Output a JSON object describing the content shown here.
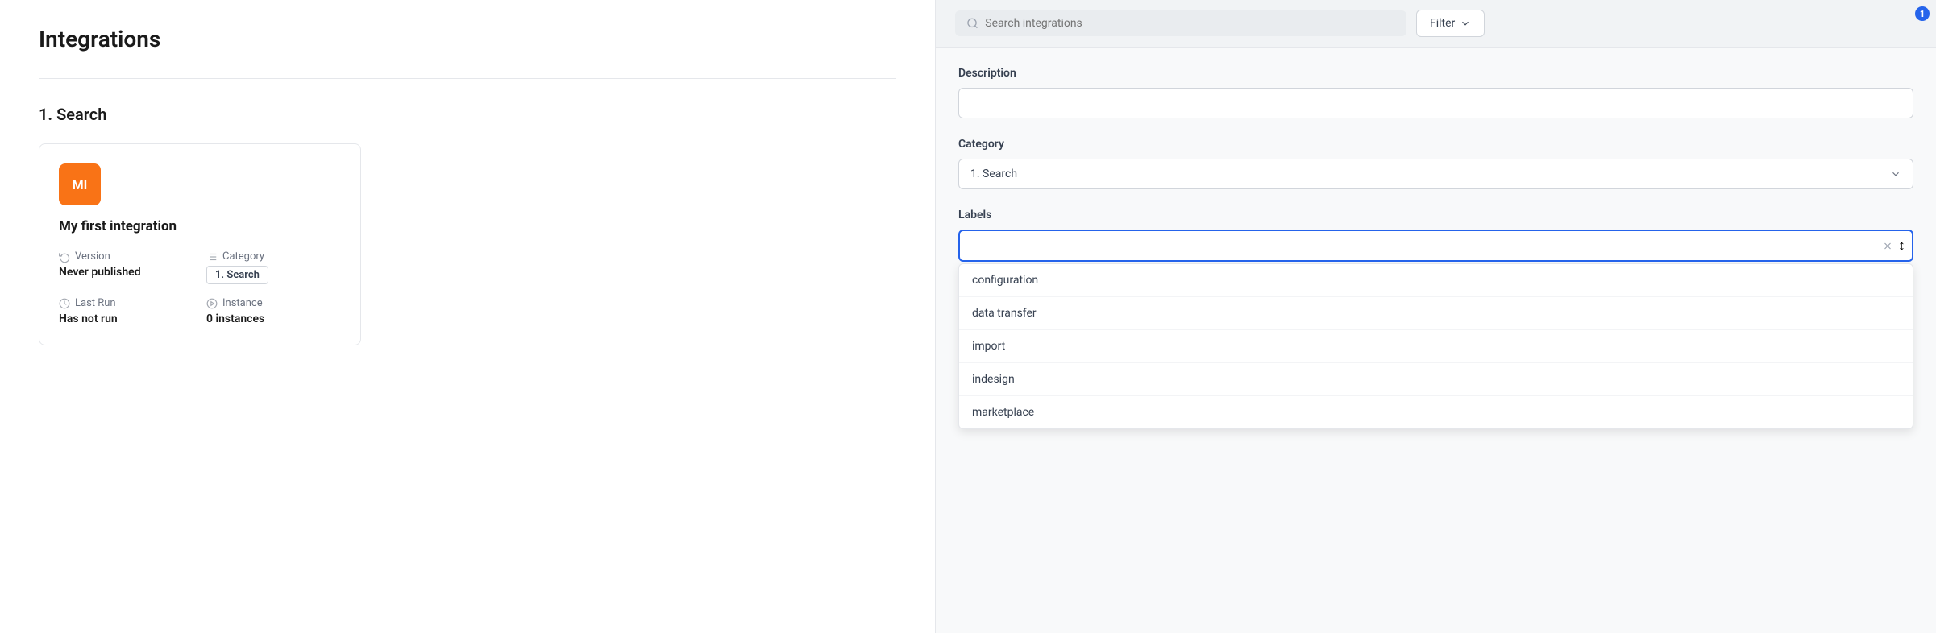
{
  "page": {
    "title": "Integrations"
  },
  "section": {
    "title": "1. Search"
  },
  "integration_card": {
    "initials": "MI",
    "name": "My first integration",
    "version_label": "Version",
    "version_value": "Never published",
    "category_label": "Category",
    "category_value": "1. Search",
    "last_run_label": "Last Run",
    "last_run_value": "Has not run",
    "instance_label": "Instance",
    "instance_value": "0 instances"
  },
  "panel": {
    "search_placeholder": "Search integrations",
    "filter_button_label": "Filter",
    "notification_count": "1",
    "description_label": "Description",
    "description_value": "",
    "category_label": "Category",
    "category_value": "1. Search",
    "labels_label": "Labels",
    "labels_value": "",
    "labels_cursor": "|"
  },
  "dropdown": {
    "items": [
      {
        "label": "configuration"
      },
      {
        "label": "data transfer"
      },
      {
        "label": "import"
      },
      {
        "label": "indesign"
      },
      {
        "label": "marketplace"
      }
    ]
  }
}
